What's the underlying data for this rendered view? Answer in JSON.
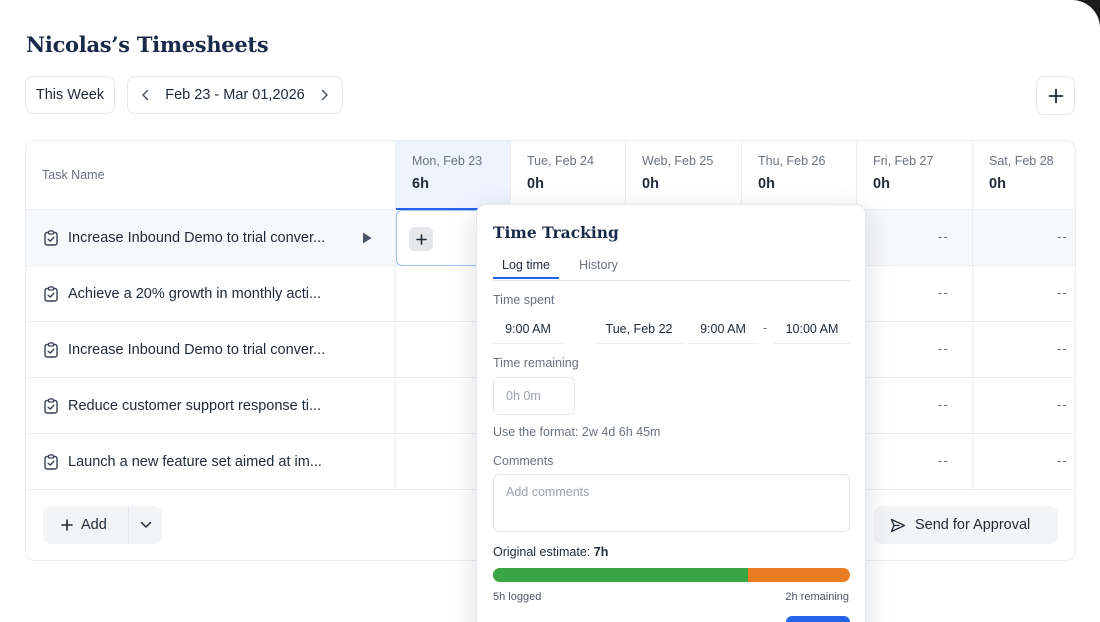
{
  "page": {
    "title": "Nicolas’s Timesheets"
  },
  "toolbar": {
    "week_button": "This Week",
    "date_range": "Feb 23 - Mar 01,2026",
    "prev_icon": "chevron-left-icon",
    "next_icon": "chevron-right-icon",
    "add_icon": "plus-icon"
  },
  "table": {
    "task_header": "Task Name",
    "days": [
      {
        "label": "Mon, Feb 23",
        "hours": "6h"
      },
      {
        "label": "Tue, Feb 24",
        "hours": "0h"
      },
      {
        "label": "Web, Feb 25",
        "hours": "0h"
      },
      {
        "label": "Thu, Feb 26",
        "hours": "0h"
      },
      {
        "label": "Fri, Feb 27",
        "hours": "0h"
      },
      {
        "label": "Sat, Feb 28",
        "hours": "0h"
      }
    ],
    "rows": [
      {
        "task": "Increase Inbound Demo to trial conver...",
        "fri": "--",
        "sat": "--"
      },
      {
        "task": "Achieve a 20% growth in monthly acti...",
        "fri": "--",
        "sat": "--"
      },
      {
        "task": "Increase Inbound Demo to trial conver...",
        "fri": "--",
        "sat": "--"
      },
      {
        "task": "Reduce customer support response ti...",
        "fri": "--",
        "sat": "--"
      },
      {
        "task": "Launch a new feature set aimed at im...",
        "fri": "--",
        "sat": "--"
      }
    ]
  },
  "footer": {
    "add_label": "Add",
    "send_label": "Send for Approval"
  },
  "popover": {
    "title": "Time Tracking",
    "tabs": [
      "Log time",
      "History"
    ],
    "time_spent_label": "Time spent",
    "time_spent": {
      "start": "9:00 AM",
      "date": "Tue, Feb 22",
      "from": "9:00 AM",
      "separator": "-",
      "to": "10:00 AM"
    },
    "time_remaining_label": "Time remaining",
    "time_remaining_placeholder": "0h 0m",
    "format_hint": "Use the format: 2w 4d 6h 45m",
    "comments_label": "Comments",
    "comments_placeholder": "Add comments",
    "estimate_label": "Original estimate:",
    "estimate_value": "7h",
    "progress_fraction": 0.7143,
    "logged_text": "5h logged",
    "remaining_text": "2h remaining",
    "colors": {
      "logged": "#3aa545",
      "remaining": "#ea7d22",
      "accent": "#2563eb"
    }
  }
}
